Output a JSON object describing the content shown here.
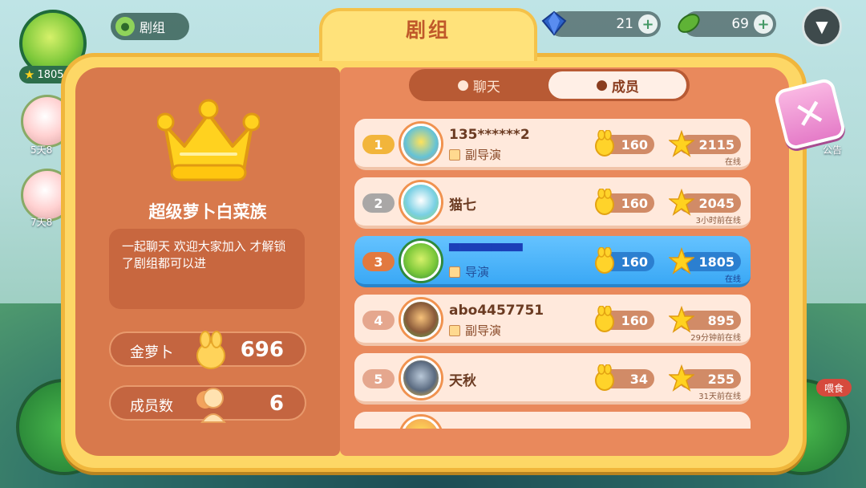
{
  "hud": {
    "level": "1805",
    "crew_label": "剧组",
    "gems": "21",
    "leaves": "69",
    "side_labels": [
      "5天8",
      "7天8"
    ],
    "right_label": "公告",
    "feed_label": "喂食"
  },
  "dialog": {
    "title": "剧组",
    "tabs": {
      "chat": "聊天",
      "members": "成员"
    },
    "crew": {
      "name": "超级萝卜白菜族",
      "description": "一起聊天 欢迎大家加入 才解锁了剧组都可以进",
      "gold_label": "金萝卜",
      "gold_value": "696",
      "members_label": "成员数",
      "members_value": "6"
    },
    "members": [
      {
        "rank": "1",
        "name": "135******2",
        "role": "副导演",
        "carrots": "160",
        "stars": "2115",
        "status": "在线"
      },
      {
        "rank": "2",
        "name": "猫七",
        "role": "",
        "carrots": "160",
        "stars": "2045",
        "status": "3小时前在线"
      },
      {
        "rank": "3",
        "name": "▀▀▀▀▀▀▀",
        "role": "导演",
        "carrots": "160",
        "stars": "1805",
        "status": "在线",
        "self": true
      },
      {
        "rank": "4",
        "name": "abo4457751",
        "role": "副导演",
        "carrots": "160",
        "stars": "895",
        "status": "29分钟前在线"
      },
      {
        "rank": "5",
        "name": "天秋",
        "role": "",
        "carrots": "34",
        "stars": "255",
        "status": "31天前在线"
      }
    ]
  },
  "icons": {
    "close": "close-icon",
    "crown": "crown-icon",
    "carrot": "gold-carrot-icon",
    "star": "star-icon",
    "member": "member-icon",
    "chat": "chat-bubble-icon",
    "menu": "chevron-down-icon"
  },
  "colors": {
    "dialog_frame": "#fdd766",
    "panel_left": "#d8794c",
    "panel_right": "#e9895c",
    "row_default": "#ffe9dc",
    "row_self": "#3aa8f5",
    "rank_gold": "#f2b53b",
    "rank_silver": "#a9a7a6",
    "rank_bronze": "#e2793f",
    "close_button": "#e57cc8"
  }
}
